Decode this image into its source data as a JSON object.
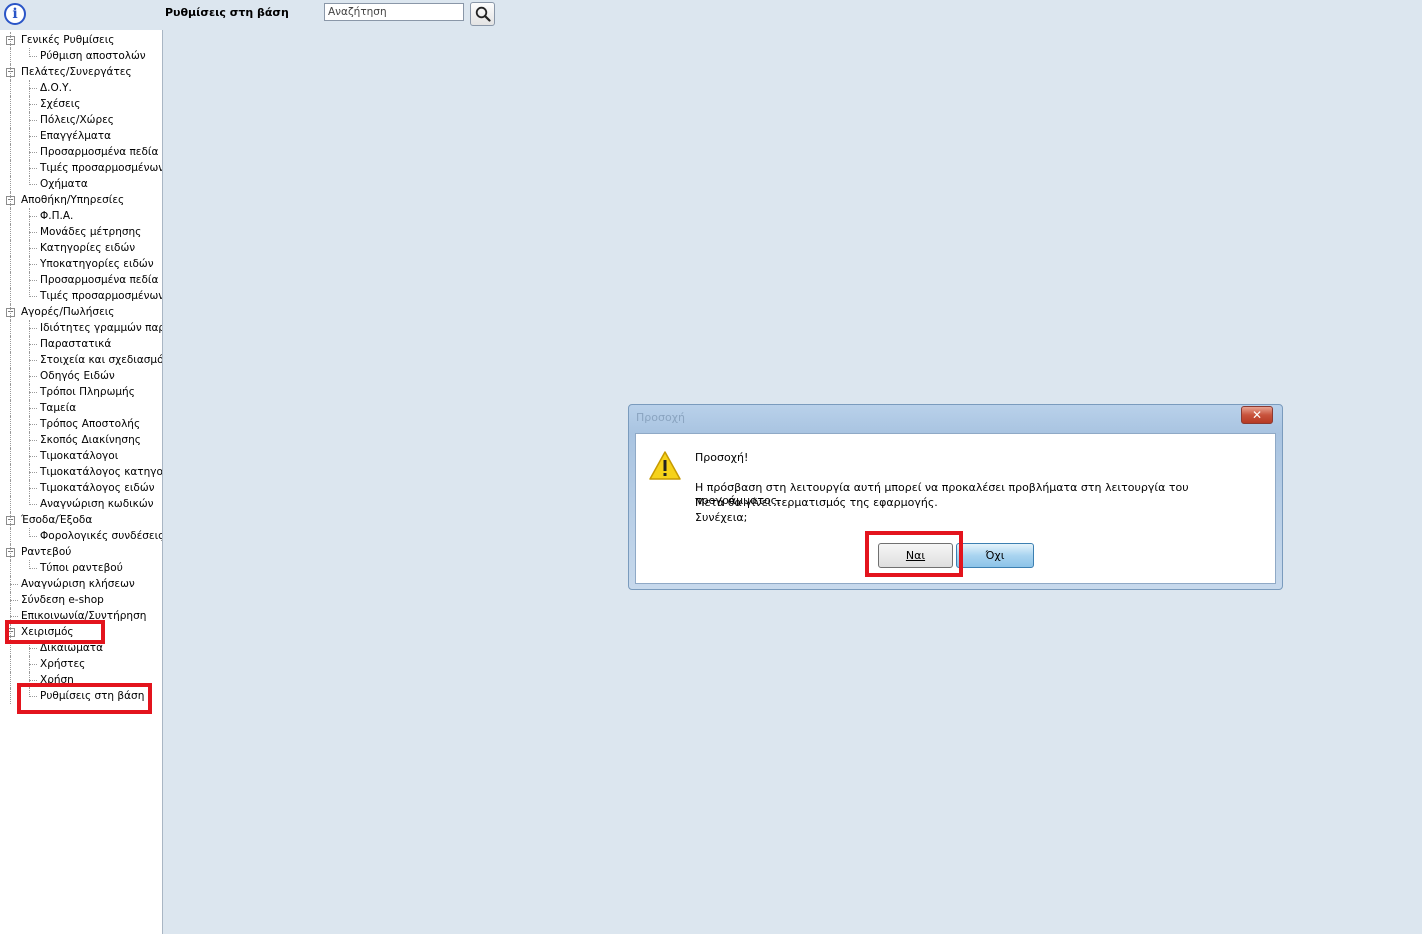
{
  "header": {
    "page_title": "Ρυθμίσεις στη βάση",
    "search_value": "Αναζήτηση"
  },
  "sidebar": {
    "tree": [
      {
        "label": "Γενικές Ρυθμίσεις",
        "level": 0,
        "expanded": true
      },
      {
        "label": "Ρύθμιση αποστολών",
        "level": 1
      },
      {
        "label": "Πελάτες/Συνεργάτες",
        "level": 0,
        "expanded": true
      },
      {
        "label": "Δ.Ο.Υ.",
        "level": 1
      },
      {
        "label": "Σχέσεις",
        "level": 1
      },
      {
        "label": "Πόλεις/Χώρες",
        "level": 1
      },
      {
        "label": "Επαγγέλματα",
        "level": 1
      },
      {
        "label": "Προσαρμοσμένα πεδία",
        "level": 1
      },
      {
        "label": "Τιμές προσαρμοσμένων πεδίων",
        "level": 1
      },
      {
        "label": "Οχήματα",
        "level": 1
      },
      {
        "label": "Αποθήκη/Υπηρεσίες",
        "level": 0,
        "expanded": true
      },
      {
        "label": "Φ.Π.Α.",
        "level": 1
      },
      {
        "label": "Μονάδες μέτρησης",
        "level": 1
      },
      {
        "label": "Κατηγορίες ειδών",
        "level": 1
      },
      {
        "label": "Υποκατηγορίες ειδών",
        "level": 1
      },
      {
        "label": "Προσαρμοσμένα πεδία",
        "level": 1
      },
      {
        "label": "Τιμές προσαρμοσμένων πεδίων",
        "level": 1
      },
      {
        "label": "Αγορές/Πωλήσεις",
        "level": 0,
        "expanded": true
      },
      {
        "label": "Ιδιότητες γραμμών παραστατικών",
        "level": 1
      },
      {
        "label": "Παραστατικά",
        "level": 1
      },
      {
        "label": "Στοιχεία και σχεδιασμός παραστατικών",
        "level": 1
      },
      {
        "label": "Οδηγός Ειδών",
        "level": 1
      },
      {
        "label": "Τρόποι Πληρωμής",
        "level": 1
      },
      {
        "label": "Ταμεία",
        "level": 1
      },
      {
        "label": "Τρόπος Αποστολής",
        "level": 1
      },
      {
        "label": "Σκοπός Διακίνησης",
        "level": 1
      },
      {
        "label": "Τιμοκατάλογοι",
        "level": 1
      },
      {
        "label": "Τιμοκατάλογος κατηγοριών",
        "level": 1
      },
      {
        "label": "Τιμοκατάλογος ειδών",
        "level": 1
      },
      {
        "label": "Αναγνώριση κωδικών",
        "level": 1
      },
      {
        "label": "Έσοδα/Έξοδα",
        "level": 0,
        "expanded": true
      },
      {
        "label": "Φορολογικές συνδέσεις",
        "level": 1
      },
      {
        "label": "Ραντεβού",
        "level": 0,
        "expanded": true
      },
      {
        "label": "Τύποι ραντεβού",
        "level": 1
      },
      {
        "label": "Αναγνώριση κλήσεων",
        "level": 0
      },
      {
        "label": "Σύνδεση e-shop",
        "level": 0
      },
      {
        "label": "Επικοινωνία/Συντήρηση",
        "level": 0
      },
      {
        "label": "Χειρισμός",
        "level": 0,
        "expanded": true
      },
      {
        "label": "Δικαιώματα",
        "level": 1
      },
      {
        "label": "Χρήστες",
        "level": 1
      },
      {
        "label": "Χρήση",
        "level": 1
      },
      {
        "label": "Ρυθμίσεις στη βάση",
        "level": 1
      }
    ]
  },
  "dialog": {
    "title": "Προσοχή",
    "close_label": "✕",
    "heading": "Προσοχή!",
    "message_line1": "Η πρόσβαση στη λειτουργία αυτή μπορεί να προκαλέσει προβλήματα στη λειτουργία του προγράμματος.",
    "message_line2": "Μετά θα γίνει τερματισμός της εφαρμογής.",
    "message_line3": "Συνέχεια;",
    "yes_label": "Ναι",
    "no_label": "Όχι"
  },
  "colors": {
    "highlight": "#e3141d",
    "background": "#dce6ef",
    "info_icon": "#2a55c7"
  }
}
